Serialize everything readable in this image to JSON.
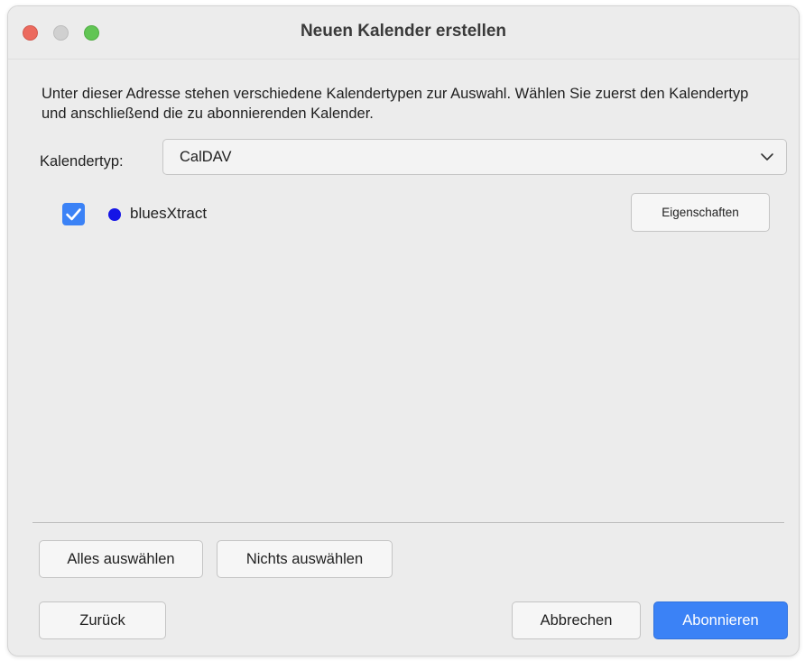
{
  "window": {
    "title": "Neuen Kalender erstellen"
  },
  "dialog": {
    "description": "Unter dieser Adresse stehen verschiedene Kalendertypen zur Auswahl. Wählen Sie zuerst den Kalendertyp und anschließend die zu abonnierenden Kalender.",
    "calendar_type_label": "Kalendertyp:",
    "calendar_type_value": "CalDAV",
    "calendars": [
      {
        "name": "bluesXtract",
        "checked": true,
        "color": "#1515e6",
        "properties_label": "Eigenschaften"
      }
    ],
    "select_all_label": "Alles auswählen",
    "select_none_label": "Nichts auswählen",
    "back_label": "Zurück",
    "cancel_label": "Abbrechen",
    "subscribe_label": "Abonnieren"
  },
  "colors": {
    "accent": "#3b82f6",
    "traffic_close": "#ec6a5e",
    "traffic_minimize_inactive": "#d0d0d0",
    "traffic_zoom": "#61c554"
  },
  "icons": {
    "dropdown": "chevron-down-icon",
    "checkbox": "checkmark-icon"
  }
}
